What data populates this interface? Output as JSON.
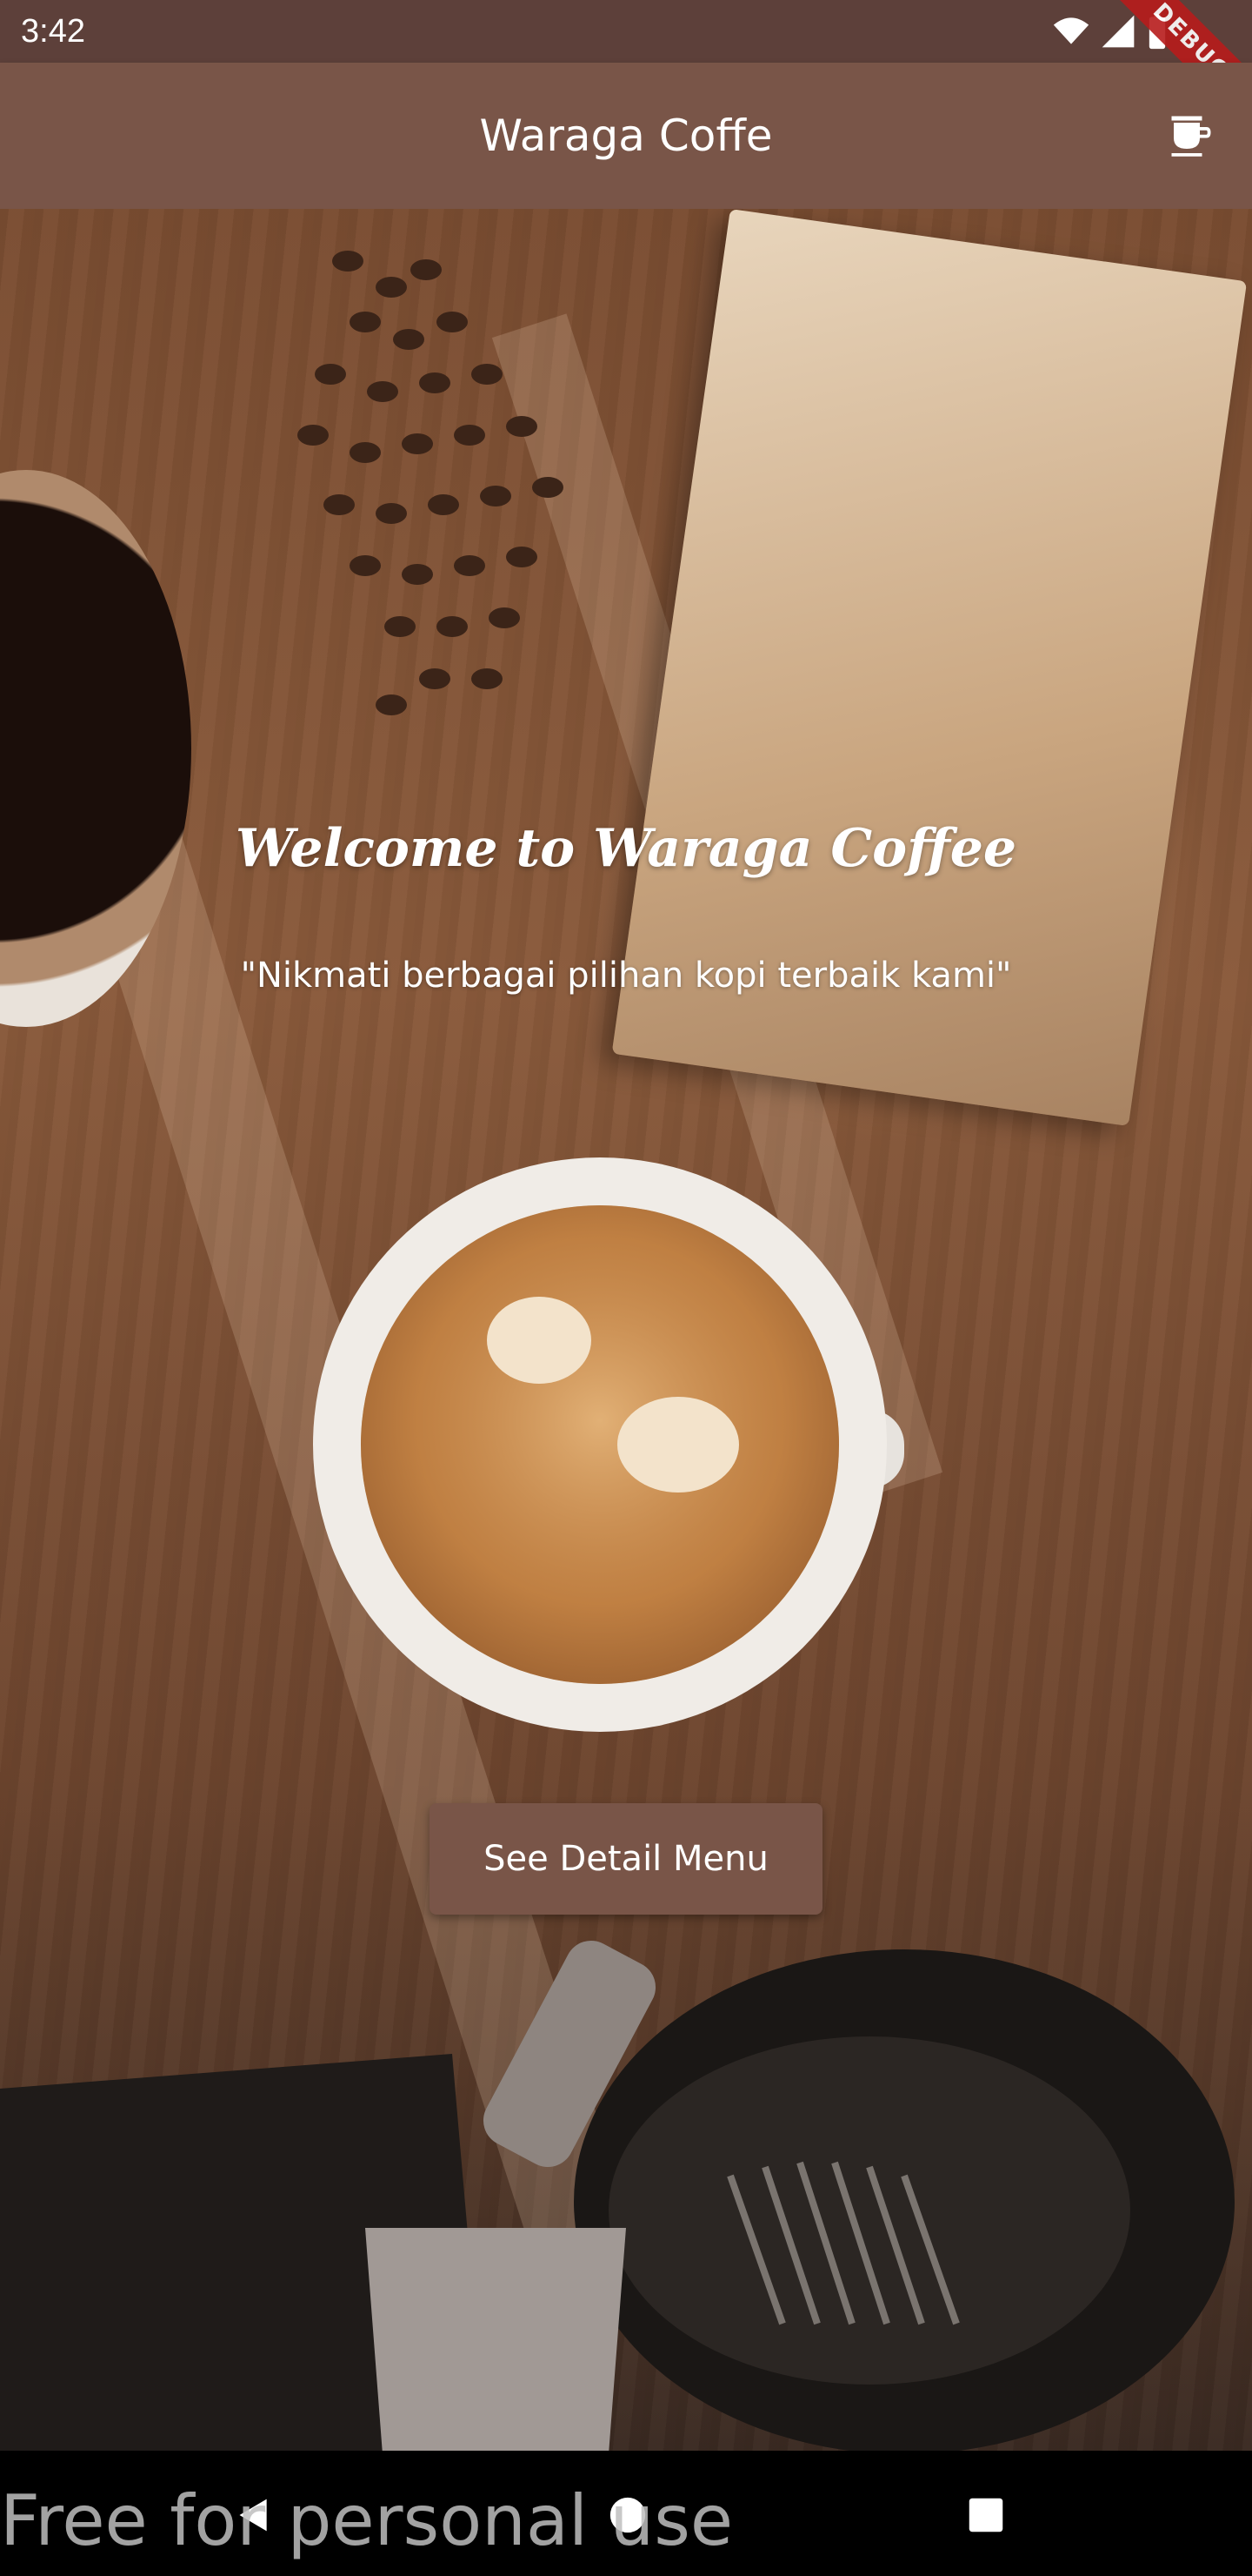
{
  "status_bar": {
    "time": "3:42",
    "icons": [
      "wifi-icon",
      "signal-icon",
      "battery-icon"
    ],
    "debug_label": "DEBUG"
  },
  "app_bar": {
    "title": "Waraga Coffe",
    "action_icon": "coffee-cup-icon"
  },
  "hero": {
    "welcome_title": "Welcome to Waraga Coffee",
    "tagline": "\"Nikmati berbagai pilihan kopi terbaik kami\"",
    "button_label": "See Detail Menu"
  },
  "nav_bar": {
    "icons": [
      "back-icon",
      "home-icon",
      "recents-icon"
    ]
  },
  "watermark": "Free for personal use",
  "colors": {
    "status_bar": "#5d403a",
    "app_bar": "#795548",
    "button": "#795548",
    "text": "#ffffff",
    "debug_ribbon": "#b71c1c"
  }
}
